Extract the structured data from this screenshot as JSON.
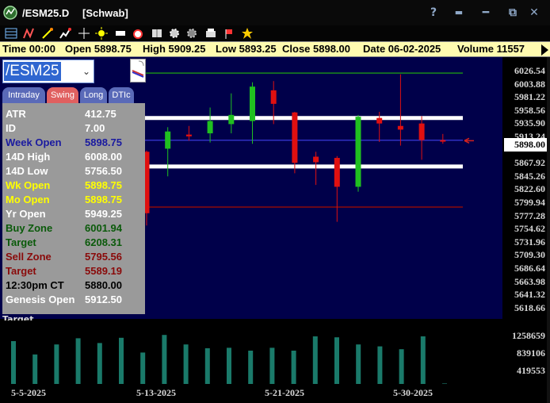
{
  "window": {
    "title": "/ESM25.D",
    "broker": "[Schwab]",
    "help_label": "?",
    "pin_label": "▬",
    "minimize_label": "━",
    "maximize_label": "⧉",
    "close_label": "✕"
  },
  "toolbar": {
    "icons": [
      "grid-icon",
      "indicator-icon",
      "draw-icon",
      "chart-add-icon",
      "crosshair-icon",
      "sun-icon",
      "rectangle-icon",
      "alarm-clock-icon",
      "book-icon",
      "gear-icon",
      "gear-dark-icon",
      "print-icon",
      "flag-icon",
      "star-icon"
    ]
  },
  "info": {
    "time": "Time 00:00",
    "open": "Open 5898.75",
    "high": "High 5909.25",
    "low": "Low 5893.25",
    "close": "Close 5898.00",
    "date": "Date 06-02-2025",
    "volume": "Volume 11557"
  },
  "symbol": {
    "value": "/ESM25"
  },
  "tabs": [
    {
      "label": "Intraday",
      "color": "#5a6ab8"
    },
    {
      "label": "Swing",
      "color": "#e06060"
    },
    {
      "label": "Long",
      "color": "#5a6ab8"
    },
    {
      "label": "DTIc",
      "color": "#5a6ab8"
    }
  ],
  "panel": {
    "rows": [
      {
        "label": "ATR",
        "value": "412.75",
        "label_color": "#ffffff",
        "value_color": "#ffffff"
      },
      {
        "label": "ID",
        "value": "7.00",
        "label_color": "#ffffff",
        "value_color": "#ffffff"
      },
      {
        "label": "Week Open",
        "value": "5898.75",
        "label_color": "#1a1aa0",
        "value_color": "#1a1aa0"
      },
      {
        "label": "14D High",
        "value": "6008.00",
        "label_color": "#ffffff",
        "value_color": "#ffffff"
      },
      {
        "label": "14D Low",
        "value": "5756.50",
        "label_color": "#ffffff",
        "value_color": "#ffffff"
      },
      {
        "label": "Wk Open",
        "value": "5898.75",
        "label_color": "#ffff00",
        "value_color": "#ffff00"
      },
      {
        "label": "Mo Open",
        "value": "5898.75",
        "label_color": "#ffff00",
        "value_color": "#ffff00"
      },
      {
        "label": "Yr Open",
        "value": "5949.25",
        "label_color": "#ffffff",
        "value_color": "#ffffff"
      },
      {
        "label": "Buy Zone",
        "value": "6001.94",
        "label_color": "#0a5a0a",
        "value_color": "#0a5a0a"
      },
      {
        "label": "Target",
        "value": "6208.31",
        "label_color": "#0a5a0a",
        "value_color": "#0a5a0a"
      },
      {
        "label": "Sell Zone",
        "value": "5795.56",
        "label_color": "#8a0a0a",
        "value_color": "#8a0a0a"
      },
      {
        "label": "Target",
        "value": "5589.19",
        "label_color": "#8a0a0a",
        "value_color": "#8a0a0a"
      },
      {
        "label": "12:30pm CT",
        "value": "5880.00",
        "label_color": "#000000",
        "value_color": "#000000"
      },
      {
        "label": "Genesis Open",
        "value": "5912.50",
        "label_color": "#ffffff",
        "value_color": "#ffffff"
      }
    ],
    "below_label": "Target"
  },
  "price_axis": {
    "labels": [
      "6026.54",
      "6003.88",
      "5981.22",
      "5958.56",
      "5935.90",
      "5913.24",
      "5898.00",
      "5867.92",
      "5845.26",
      "5822.60",
      "5799.94",
      "5777.28",
      "5754.62",
      "5731.96",
      "5709.30",
      "5686.64",
      "5663.98",
      "5641.32",
      "5618.66"
    ],
    "current": "5898.00"
  },
  "volume_axis": {
    "labels": [
      "1258659",
      "839106",
      "419553"
    ]
  },
  "date_axis": {
    "labels": [
      "5-5-2025",
      "5-13-2025",
      "5-21-2025",
      "5-30-2025"
    ]
  },
  "chart_data": {
    "type": "candlestick",
    "ylim": [
      5608,
      6034
    ],
    "levels": [
      {
        "name": "14D High",
        "value": 6008.0,
        "color": "#1a8a1a"
      },
      {
        "name": "upper band",
        "value": 5935.0,
        "color": "#ffffff"
      },
      {
        "name": "Week Open",
        "value": 5898.75,
        "color": "#3030c0"
      },
      {
        "name": "lower band",
        "value": 5856.0,
        "color": "#ffffff"
      },
      {
        "name": "14D Low",
        "value": 5790.0,
        "color": "#8a0a0a"
      }
    ],
    "candles": [
      {
        "o": 5880,
        "h": 5882,
        "l": 5760,
        "c": 5780
      },
      {
        "o": 5885,
        "h": 5920,
        "l": 5840,
        "c": 5913
      },
      {
        "o": 5908,
        "h": 5922,
        "l": 5898,
        "c": 5905
      },
      {
        "o": 5910,
        "h": 5952,
        "l": 5895,
        "c": 5930
      },
      {
        "o": 5925,
        "h": 5975,
        "l": 5910,
        "c": 5940
      },
      {
        "o": 5930,
        "h": 5993,
        "l": 5893,
        "c": 5986
      },
      {
        "o": 5980,
        "h": 5995,
        "l": 5925,
        "c": 5958
      },
      {
        "o": 5944,
        "h": 5945,
        "l": 5845,
        "c": 5862
      },
      {
        "o": 5872,
        "h": 5880,
        "l": 5826,
        "c": 5863
      },
      {
        "o": 5870,
        "h": 5873,
        "l": 5766,
        "c": 5823
      },
      {
        "o": 5823,
        "h": 5940,
        "l": 5815,
        "c": 5937
      },
      {
        "o": 5935,
        "h": 5945,
        "l": 5896,
        "c": 5926
      },
      {
        "o": 5922,
        "h": 6006,
        "l": 5890,
        "c": 5916
      },
      {
        "o": 5926,
        "h": 5938,
        "l": 5867,
        "c": 5899
      },
      {
        "o": 5899,
        "h": 5909,
        "l": 5893,
        "c": 5898
      }
    ],
    "volumes": [
      900000,
      620000,
      830000,
      960000,
      860000,
      970000,
      660000,
      1030000,
      830000,
      750000,
      760000,
      700000,
      760000,
      700000,
      1000000,
      980000,
      830000,
      790000,
      730000,
      1000000,
      10000
    ]
  }
}
